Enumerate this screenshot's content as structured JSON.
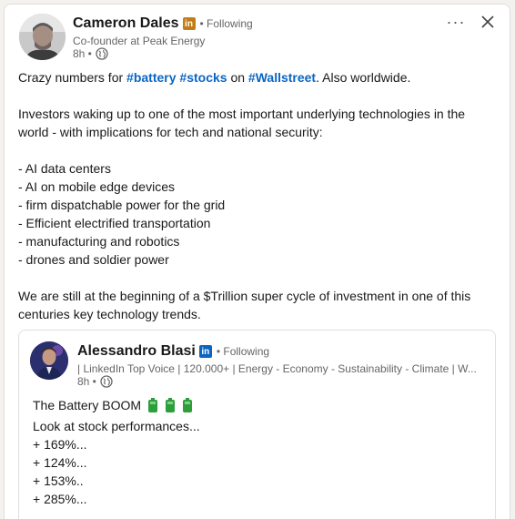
{
  "post": {
    "author": {
      "name": "Cameron Dales",
      "badge": "in",
      "follow_status": "• Following",
      "headline": "Co-founder at Peak Energy",
      "time": "8h •"
    },
    "actions": {
      "more_label": "···",
      "close_icon": "close-icon"
    },
    "body": {
      "line1_prefix": "Crazy numbers for ",
      "tag1": "#battery",
      "tag2": "#stocks",
      "line1_mid": " on ",
      "tag3": "#Wallstreet",
      "line1_suffix": ". Also worldwide.",
      "para2_line1": "Investors waking up to one of the most important underlying technologies in the",
      "para2_line2": "world - with implications for tech and national security:",
      "bullets": [
        "- AI data centers",
        "- AI on mobile edge devices",
        "- firm dispatchable power for the grid",
        "- Efficient electrified transportation",
        "- manufacturing and robotics",
        "- drones and soldier power"
      ],
      "para3_line1": "We are still at the beginning of a $Trillion super cycle of investment in one of this",
      "para3_line2": "centuries key technology trends."
    }
  },
  "shared_post": {
    "author": {
      "name": "Alessandro Blasi",
      "badge": "in",
      "follow_status": "• Following",
      "headline": "| LinkedIn Top Voice | 120.000+ | Energy - Economy - Sustainability - Climate | W...",
      "time": "8h •"
    },
    "body": {
      "line1": "The Battery BOOM",
      "line2": "Look at stock performances...",
      "gains": [
        "+ 169%...",
        "+ 124%...",
        "+ 153%..",
        "+ 285%..."
      ]
    }
  },
  "colors": {
    "link": "#0a66c2",
    "text": "#191919",
    "muted": "#666666",
    "premium_gold": "#c37d16",
    "battery_green": "#2e9e3a"
  }
}
